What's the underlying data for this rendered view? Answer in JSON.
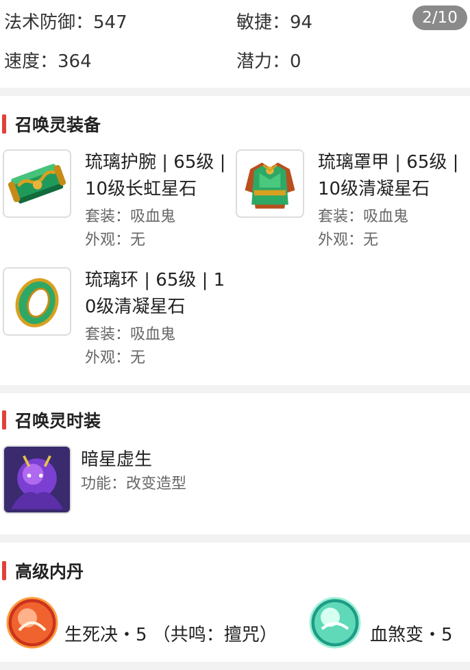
{
  "stats": {
    "magic_defense": "法术防御：547",
    "agility": "敏捷：94",
    "speed": "速度：364",
    "potential": "潜力：0",
    "page_indicator": "2/10"
  },
  "equipment": {
    "title": "召唤灵装备",
    "items": [
      {
        "name": "琉璃护腕 | 65级 | 10级长虹星石",
        "set": "套装：吸血鬼",
        "appearance": "外观：无",
        "icon": "jade-bracer-icon"
      },
      {
        "name": "琉璃罩甲 | 65级 | 10级清凝星石",
        "set": "套装：吸血鬼",
        "appearance": "外观：无",
        "icon": "jade-armor-icon"
      },
      {
        "name": "琉璃环 | 65级 | 10级清凝星石",
        "set": "套装：吸血鬼",
        "appearance": "外观：无",
        "icon": "jade-ring-icon"
      }
    ]
  },
  "costume": {
    "title": "召唤灵时装",
    "name": "暗星虚生",
    "function": "功能：改变造型",
    "icon": "dark-star-costume-icon"
  },
  "inner_core": {
    "title": "高级内丹",
    "items": [
      {
        "label": "生死决・5 （共鸣：擅咒）",
        "icon": "fire-core-icon",
        "color": "#e8542a"
      },
      {
        "label": "血煞变・5",
        "icon": "water-core-icon",
        "color": "#3fc7a4"
      }
    ]
  },
  "colors": {
    "accent": "#e0413b",
    "badge": "#8a8a8a",
    "divider": "#f2f2f2"
  }
}
